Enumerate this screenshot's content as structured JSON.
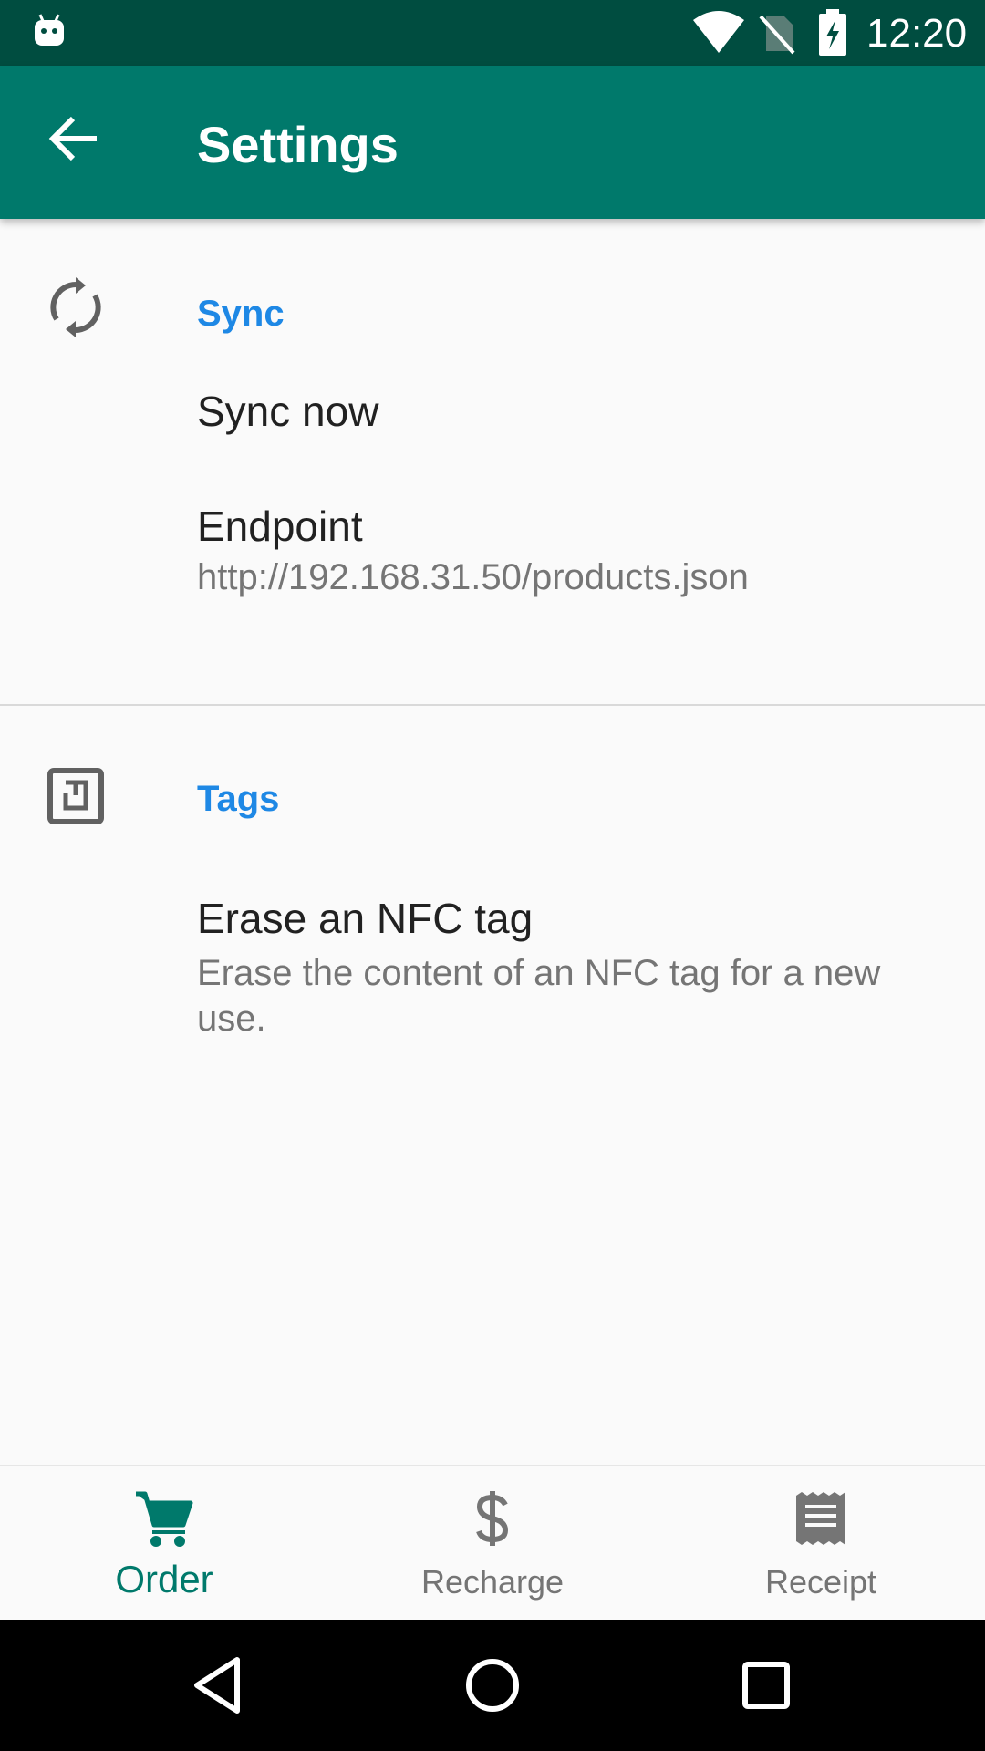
{
  "status_bar": {
    "time": "12:20",
    "icons": [
      "android-icon",
      "wifi-icon",
      "no-sim-icon",
      "battery-charging-icon"
    ]
  },
  "app_bar": {
    "title": "Settings",
    "back_icon": "arrow-back-icon"
  },
  "categories": [
    {
      "title": "Sync",
      "icon": "sync-icon",
      "preferences": [
        {
          "title": "Sync now"
        },
        {
          "title": "Endpoint",
          "summary": "http://192.168.31.50/products.json"
        }
      ]
    },
    {
      "title": "Tags",
      "icon": "nfc-icon",
      "preferences": [
        {
          "title": "Erase an NFC tag",
          "summary": "Erase the content of an NFC tag for a new use."
        }
      ]
    }
  ],
  "bottom_nav": {
    "items": [
      {
        "label": "Order",
        "icon": "cart-icon",
        "selected": true
      },
      {
        "label": "Recharge",
        "icon": "dollar-icon",
        "selected": false
      },
      {
        "label": "Receipt",
        "icon": "receipt-icon",
        "selected": false
      }
    ]
  },
  "colors": {
    "status_bar": "#004d40",
    "app_bar": "#00796b",
    "category_accent": "#1e88e5",
    "nav_selected": "#00796b",
    "nav_unselected": "#757575"
  },
  "system_nav": {
    "icons": [
      "back-triangle-icon",
      "home-circle-icon",
      "recents-square-icon"
    ]
  }
}
